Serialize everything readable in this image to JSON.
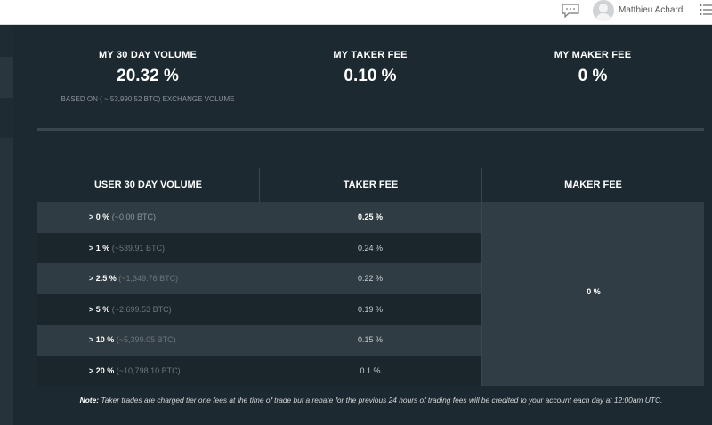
{
  "header": {
    "username": "Matthieu Achard",
    "icons": [
      "chat-icon",
      "avatar",
      "menu-icon"
    ]
  },
  "stats": [
    {
      "label": "MY 30 DAY VOLUME",
      "value": "20.32 %",
      "sub": "BASED ON ( ~ 53,990.52 BTC) EXCHANGE VOLUME"
    },
    {
      "label": "MY TAKER FEE",
      "value": "0.10 %",
      "sub": "---"
    },
    {
      "label": "MY MAKER FEE",
      "value": "0 %",
      "sub": "---"
    }
  ],
  "table": {
    "headers": [
      "USER 30 DAY VOLUME",
      "TAKER FEE",
      "MAKER FEE"
    ],
    "rows": [
      {
        "pct": "> 0 %",
        "btc": "(~0.00 BTC)",
        "taker": "0.25 %"
      },
      {
        "pct": "> 1 %",
        "btc": "(~539.91 BTC)",
        "taker": "0.24 %"
      },
      {
        "pct": "> 2.5 %",
        "btc": "(~1,349.76 BTC)",
        "taker": "0.22 %"
      },
      {
        "pct": "> 5 %",
        "btc": "(~2,699.53 BTC)",
        "taker": "0.19 %"
      },
      {
        "pct": "> 10 %",
        "btc": "(~5,399.05 BTC)",
        "taker": "0.15 %"
      },
      {
        "pct": "> 20 %",
        "btc": "(~10,798.10 BTC)",
        "taker": "0.1 %"
      }
    ],
    "maker_fee": "0 %"
  },
  "note": {
    "label": "Note:",
    "text": "Taker trades are charged tier one fees at the time of trade but a rebate for the previous 24 hours of trading fees will be credited to your account each day at 12:00am UTC."
  },
  "colors": {
    "background": "#1d2930",
    "row_light": "#303c43",
    "row_dark": "#1a252c"
  }
}
